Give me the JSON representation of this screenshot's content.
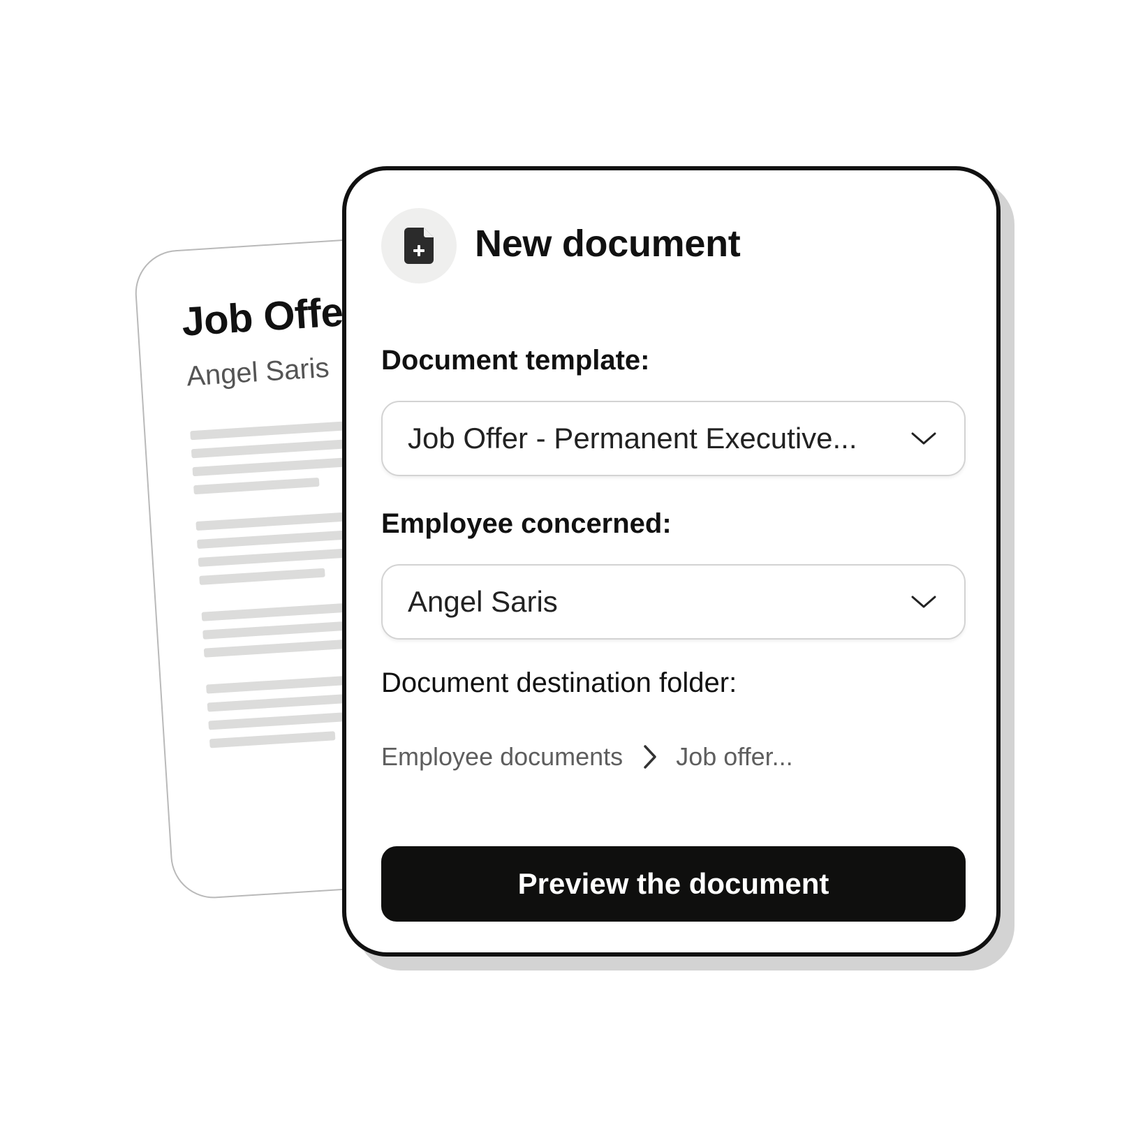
{
  "background_document": {
    "title": "Job Offer",
    "employee_name": "Angel Saris"
  },
  "dialog": {
    "title": "New document",
    "header_icon": "file-plus-icon",
    "template_field": {
      "label": "Document template:",
      "value": "Job Offer - Permanent Executive..."
    },
    "employee_field": {
      "label": "Employee concerned:",
      "value": "Angel Saris"
    },
    "destination_field": {
      "label": "Document destination folder:",
      "breadcrumb": [
        "Employee documents",
        "Job offer..."
      ]
    },
    "primary_button_label": "Preview the document"
  },
  "colors": {
    "primary_button": "#0f0f0e",
    "card_border": "#111111",
    "card_shadow": "#d3d3d3",
    "placeholder_lines": "#dcdcdb"
  }
}
